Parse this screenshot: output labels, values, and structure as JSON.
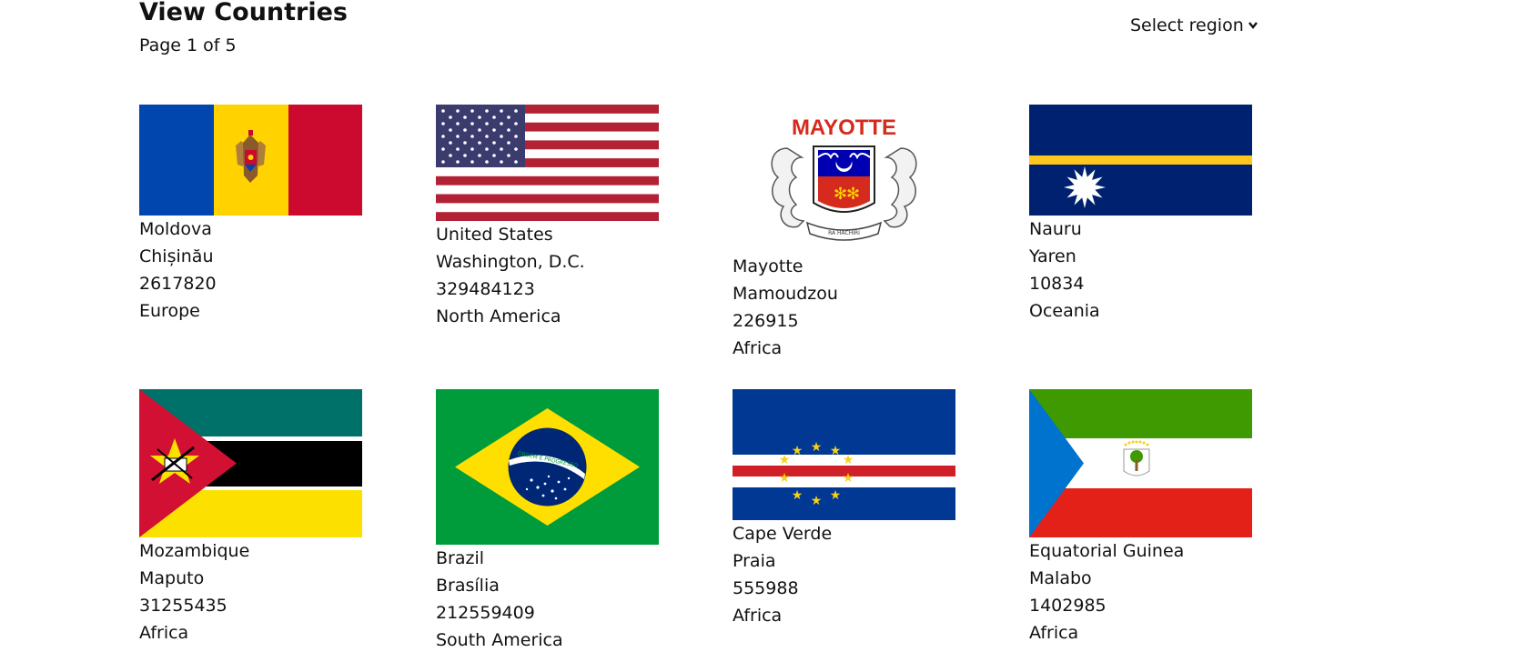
{
  "page": {
    "title": "View Countries",
    "pagination": "Page 1 of 5",
    "region_select": "Select region",
    "chevron_icon": "chevron-down-icon"
  },
  "countries": [
    {
      "name": "Moldova",
      "capital": "Chișinău",
      "population": "2617820",
      "region": "Europe",
      "flag_icon": "flag-moldova-icon"
    },
    {
      "name": "United States",
      "capital": "Washington, D.C.",
      "population": "329484123",
      "region": "North America",
      "flag_icon": "flag-united-states-icon"
    },
    {
      "name": "Mayotte",
      "capital": "Mamoudzou",
      "population": "226915",
      "region": "Africa",
      "flag_icon": "flag-mayotte-icon",
      "flag_text": "MAYOTTE",
      "flag_motto": "RA HACHIRI"
    },
    {
      "name": "Nauru",
      "capital": "Yaren",
      "population": "10834",
      "region": "Oceania",
      "flag_icon": "flag-nauru-icon"
    },
    {
      "name": "Mozambique",
      "capital": "Maputo",
      "population": "31255435",
      "region": "Africa",
      "flag_icon": "flag-mozambique-icon"
    },
    {
      "name": "Brazil",
      "capital": "Brasília",
      "population": "212559409",
      "region": "South America",
      "flag_icon": "flag-brazil-icon",
      "flag_motto": "ORDEM E PROGRESSO"
    },
    {
      "name": "Cape Verde",
      "capital": "Praia",
      "population": "555988",
      "region": "Africa",
      "flag_icon": "flag-cape-verde-icon"
    },
    {
      "name": "Equatorial Guinea",
      "capital": "Malabo",
      "population": "1402985",
      "region": "Africa",
      "flag_icon": "flag-equatorial-guinea-icon"
    }
  ],
  "colors": {
    "text": "#111111",
    "background": "#ffffff"
  }
}
